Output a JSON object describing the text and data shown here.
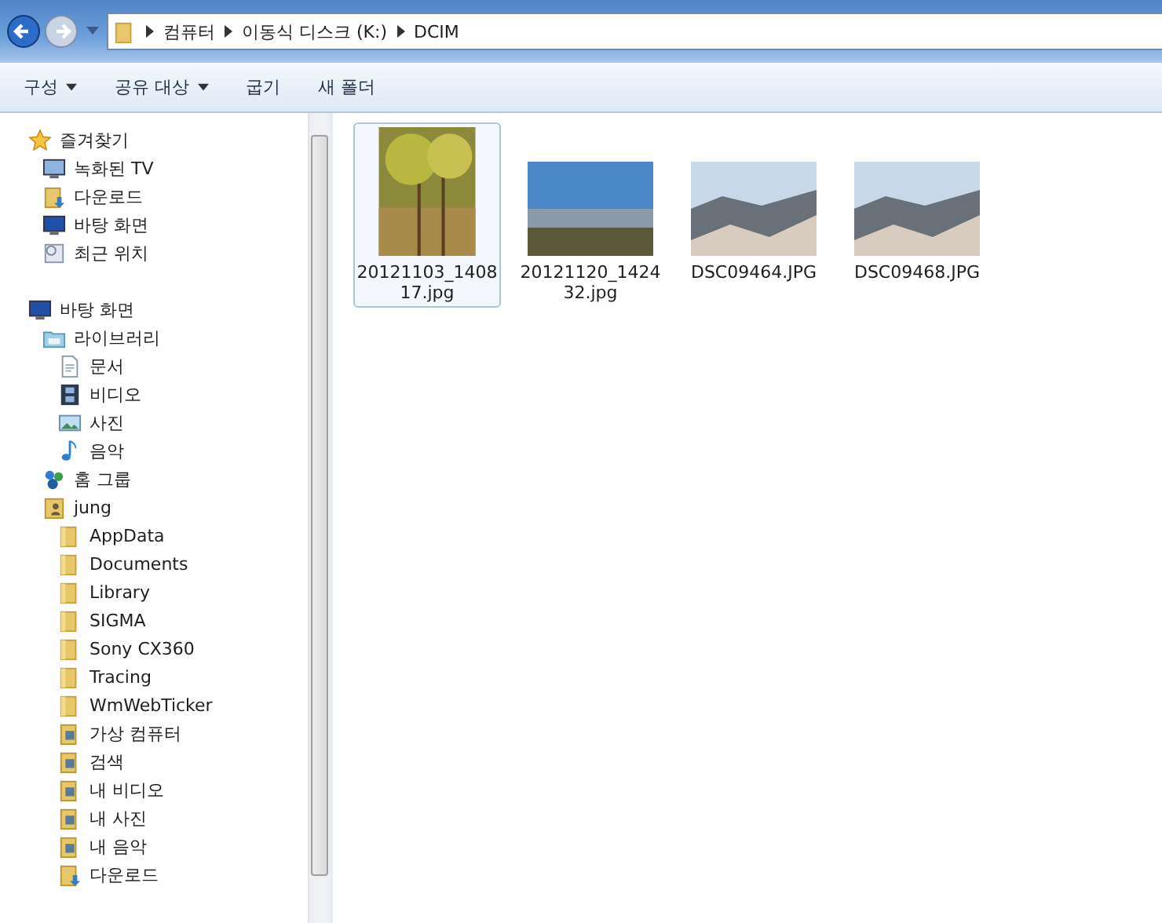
{
  "address": {
    "crumbs": [
      "컴퓨터",
      "이동식 디스크 (K:)",
      "DCIM"
    ]
  },
  "toolbar": [
    {
      "label": "구성",
      "menu": true
    },
    {
      "label": "공유 대상",
      "menu": true
    },
    {
      "label": "굽기",
      "menu": false
    },
    {
      "label": "새 폴더",
      "menu": false
    }
  ],
  "nav_tree": [
    {
      "label": "즐겨찾기",
      "kind": "star",
      "children": [
        {
          "label": "녹화된 TV",
          "kind": "tv"
        },
        {
          "label": "다운로드",
          "kind": "download"
        },
        {
          "label": "바탕 화면",
          "kind": "desktop"
        },
        {
          "label": "최근 위치",
          "kind": "recent"
        }
      ]
    },
    {
      "label": "바탕 화면",
      "kind": "desktop",
      "children": [
        {
          "label": "라이브러리",
          "kind": "library",
          "children": [
            {
              "label": "문서",
              "kind": "document"
            },
            {
              "label": "비디오",
              "kind": "video"
            },
            {
              "label": "사진",
              "kind": "picture"
            },
            {
              "label": "음악",
              "kind": "music"
            }
          ]
        },
        {
          "label": "홈 그룹",
          "kind": "homegroup"
        },
        {
          "label": "jung",
          "kind": "user",
          "children": [
            {
              "label": "AppData",
              "kind": "folder"
            },
            {
              "label": "Documents",
              "kind": "folder"
            },
            {
              "label": "Library",
              "kind": "folder"
            },
            {
              "label": "SIGMA",
              "kind": "folder"
            },
            {
              "label": "Sony CX360",
              "kind": "folder"
            },
            {
              "label": "Tracing",
              "kind": "folder"
            },
            {
              "label": "WmWebTicker",
              "kind": "folder"
            },
            {
              "label": "가상 컴퓨터",
              "kind": "special"
            },
            {
              "label": "검색",
              "kind": "special"
            },
            {
              "label": "내 비디오",
              "kind": "special"
            },
            {
              "label": "내 사진",
              "kind": "special"
            },
            {
              "label": "내 음악",
              "kind": "special"
            },
            {
              "label": "다운로드",
              "kind": "download"
            }
          ]
        }
      ]
    }
  ],
  "files": [
    {
      "name": "20121103_140817.jpg",
      "kind": "portrait",
      "selected": true
    },
    {
      "name": "20121120_142432.jpg",
      "kind": "city",
      "selected": false
    },
    {
      "name": "DSC09464.JPG",
      "kind": "mountain",
      "selected": false
    },
    {
      "name": "DSC09468.JPG",
      "kind": "mountain",
      "selected": false
    }
  ]
}
